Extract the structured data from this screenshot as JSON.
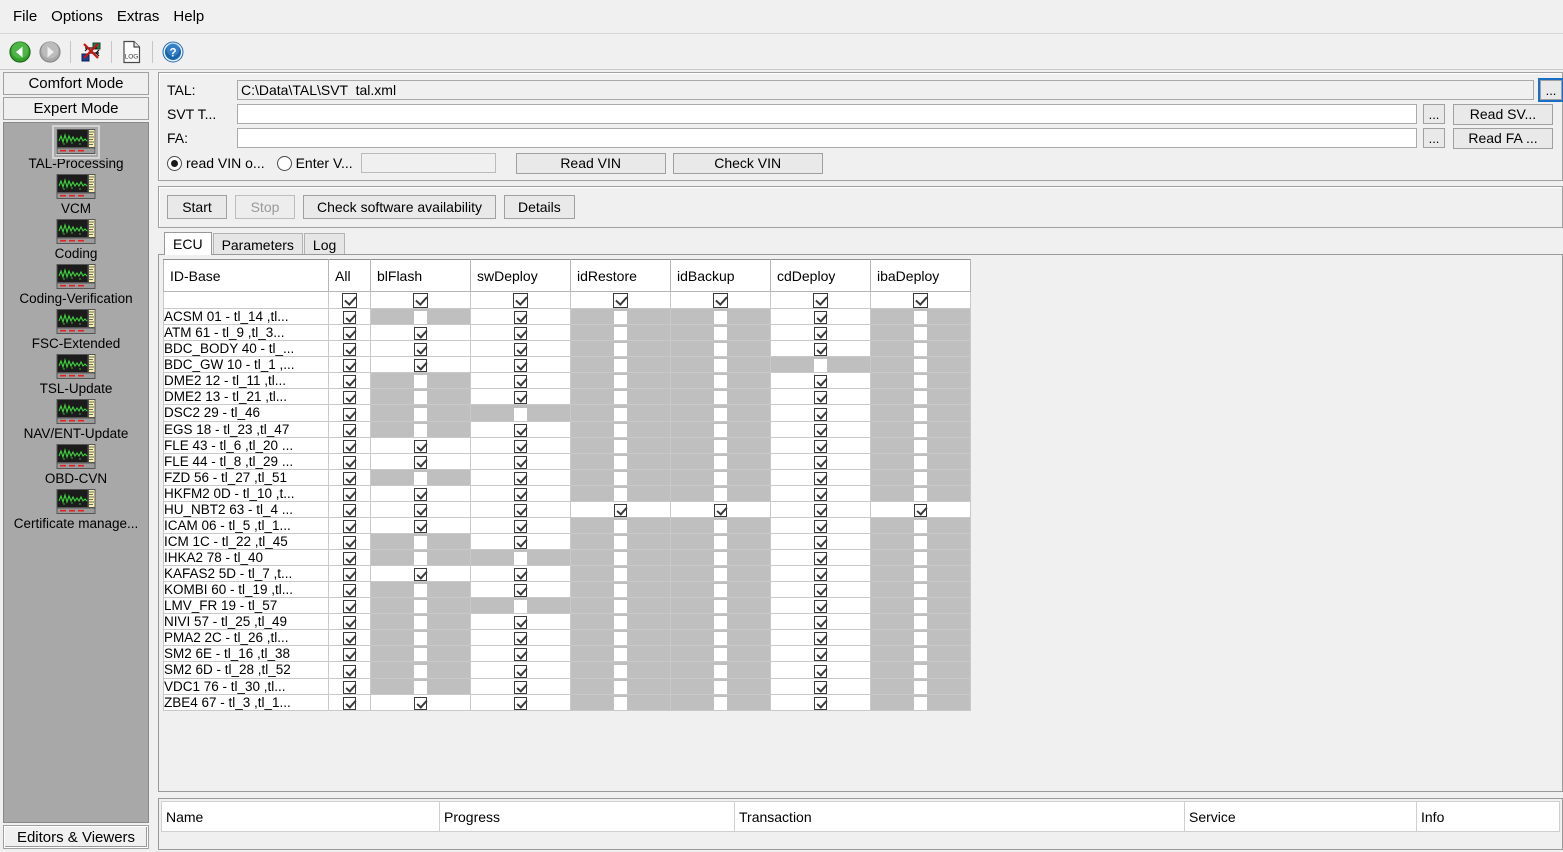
{
  "menubar": [
    "File",
    "Options",
    "Extras",
    "Help"
  ],
  "toolbar": {
    "buttons": [
      {
        "name": "back-icon",
        "title": "Back"
      },
      {
        "name": "forward-icon",
        "title": "Forward"
      },
      {
        "name": "network-icon",
        "title": "Connections"
      },
      {
        "name": "log-document-icon",
        "title": "Log"
      },
      {
        "name": "help-icon",
        "title": "Help"
      }
    ]
  },
  "sidebar": {
    "comfort_mode": "Comfort Mode",
    "expert_mode": "Expert Mode",
    "editors_viewers": "Editors & Viewers",
    "items": [
      {
        "label": "TAL-Processing",
        "selected": true
      },
      {
        "label": "VCM",
        "selected": false
      },
      {
        "label": "Coding",
        "selected": false
      },
      {
        "label": "Coding-Verification",
        "selected": false
      },
      {
        "label": "FSC-Extended",
        "selected": false
      },
      {
        "label": "TSL-Update",
        "selected": false
      },
      {
        "label": "NAV/ENT-Update",
        "selected": false
      },
      {
        "label": "OBD-CVN",
        "selected": false
      },
      {
        "label": "Certificate manage...",
        "selected": false
      }
    ]
  },
  "form": {
    "tal_label": "TAL:",
    "tal_value": "C:\\Data\\TAL\\SVT  tal.xml",
    "svt_label": "SVT T...",
    "svt_value": "",
    "fa_label": "FA:",
    "fa_value": "",
    "browse_label": "...",
    "read_svt_label": "Read SV...",
    "read_fa_label": "Read FA ...",
    "radio_read_vin": "read VIN o...",
    "radio_enter_vin": "Enter V...",
    "vin_value": "",
    "read_vin_button": "Read VIN",
    "check_vin_button": "Check VIN"
  },
  "actions": {
    "start": "Start",
    "stop": "Stop",
    "check_availability": "Check software availability",
    "details": "Details"
  },
  "tabs": [
    {
      "label": "ECU",
      "active": true
    },
    {
      "label": "Parameters",
      "active": false
    },
    {
      "label": "Log",
      "active": false
    }
  ],
  "grid": {
    "columns": [
      "ID-Base",
      "All",
      "blFlash",
      "swDeploy",
      "idRestore",
      "idBackup",
      "cdDeploy",
      "ibaDeploy"
    ],
    "filter_row": [
      null,
      "checked",
      "checked",
      "checked",
      "checked",
      "checked",
      "checked",
      "checked"
    ],
    "rows": [
      {
        "name": "ACSM 01 - tl_14 ,tl...",
        "cells": [
          "checked",
          "disabled",
          "checked",
          "disabled",
          "disabled",
          "checked",
          "disabled"
        ]
      },
      {
        "name": "ATM 61 - tl_9 ,tl_3...",
        "cells": [
          "checked",
          "checked",
          "checked",
          "disabled",
          "disabled",
          "checked",
          "disabled"
        ]
      },
      {
        "name": "BDC_BODY 40 - tl_...",
        "cells": [
          "checked",
          "checked",
          "checked",
          "disabled",
          "disabled",
          "checked",
          "disabled"
        ]
      },
      {
        "name": "BDC_GW 10 - tl_1 ,...",
        "cells": [
          "checked",
          "checked",
          "checked",
          "disabled",
          "disabled",
          "disabled",
          "disabled"
        ]
      },
      {
        "name": "DME2 12 - tl_11 ,tl...",
        "cells": [
          "checked",
          "disabled",
          "checked",
          "disabled",
          "disabled",
          "checked",
          "disabled"
        ]
      },
      {
        "name": "DME2 13 - tl_21 ,tl...",
        "cells": [
          "checked",
          "disabled",
          "checked",
          "disabled",
          "disabled",
          "checked",
          "disabled"
        ]
      },
      {
        "name": "DSC2 29 - tl_46",
        "cells": [
          "checked",
          "disabled",
          "disabled",
          "disabled",
          "disabled",
          "checked",
          "disabled"
        ]
      },
      {
        "name": "EGS 18 - tl_23 ,tl_47",
        "cells": [
          "checked",
          "disabled",
          "checked",
          "disabled",
          "disabled",
          "checked",
          "disabled"
        ]
      },
      {
        "name": "FLE 43 - tl_6 ,tl_20 ...",
        "cells": [
          "checked",
          "checked",
          "checked",
          "disabled",
          "disabled",
          "checked",
          "disabled"
        ]
      },
      {
        "name": "FLE 44 - tl_8 ,tl_29 ...",
        "cells": [
          "checked",
          "checked",
          "checked",
          "disabled",
          "disabled",
          "checked",
          "disabled"
        ]
      },
      {
        "name": "FZD 56 - tl_27 ,tl_51",
        "cells": [
          "checked",
          "disabled",
          "checked",
          "disabled",
          "disabled",
          "checked",
          "disabled"
        ]
      },
      {
        "name": "HKFM2 0D - tl_10 ,t...",
        "cells": [
          "checked",
          "checked",
          "checked",
          "disabled",
          "disabled",
          "checked",
          "disabled"
        ]
      },
      {
        "name": "HU_NBT2 63 - tl_4 ...",
        "cells": [
          "checked",
          "checked",
          "checked",
          "checked",
          "checked",
          "checked",
          "checked"
        ]
      },
      {
        "name": "ICAM 06 - tl_5 ,tl_1...",
        "cells": [
          "checked",
          "checked",
          "checked",
          "disabled",
          "disabled",
          "checked",
          "disabled"
        ]
      },
      {
        "name": "ICM 1C - tl_22 ,tl_45",
        "cells": [
          "checked",
          "disabled",
          "checked",
          "disabled",
          "disabled",
          "checked",
          "disabled"
        ]
      },
      {
        "name": "IHKA2 78 - tl_40",
        "cells": [
          "checked",
          "disabled",
          "disabled",
          "disabled",
          "disabled",
          "checked",
          "disabled"
        ]
      },
      {
        "name": "KAFAS2 5D - tl_7 ,t...",
        "cells": [
          "checked",
          "checked",
          "checked",
          "disabled",
          "disabled",
          "checked",
          "disabled"
        ]
      },
      {
        "name": "KOMBI 60 - tl_19 ,tl...",
        "cells": [
          "checked",
          "disabled",
          "checked",
          "disabled",
          "disabled",
          "checked",
          "disabled"
        ]
      },
      {
        "name": "LMV_FR 19 - tl_57",
        "cells": [
          "checked",
          "disabled",
          "disabled",
          "disabled",
          "disabled",
          "checked",
          "disabled"
        ]
      },
      {
        "name": "NIVI 57 - tl_25 ,tl_49",
        "cells": [
          "checked",
          "disabled",
          "checked",
          "disabled",
          "disabled",
          "checked",
          "disabled"
        ]
      },
      {
        "name": "PMA2 2C - tl_26 ,tl...",
        "cells": [
          "checked",
          "disabled",
          "checked",
          "disabled",
          "disabled",
          "checked",
          "disabled"
        ]
      },
      {
        "name": "SM2 6E - tl_16 ,tl_38",
        "cells": [
          "checked",
          "disabled",
          "checked",
          "disabled",
          "disabled",
          "checked",
          "disabled"
        ]
      },
      {
        "name": "SM2 6D - tl_28 ,tl_52",
        "cells": [
          "checked",
          "disabled",
          "checked",
          "disabled",
          "disabled",
          "checked",
          "disabled"
        ]
      },
      {
        "name": "VDC1 76 - tl_30 ,tl...",
        "cells": [
          "checked",
          "disabled",
          "checked",
          "disabled",
          "disabled",
          "checked",
          "disabled"
        ]
      },
      {
        "name": "ZBE4 67 - tl_3 ,tl_1...",
        "cells": [
          "checked",
          "checked",
          "checked",
          "disabled",
          "disabled",
          "checked",
          "disabled"
        ]
      }
    ]
  },
  "status_table": {
    "columns": [
      "Name",
      "Progress",
      "Transaction",
      "Service",
      "Info"
    ],
    "rows": []
  },
  "colors": {
    "disabled_cell": "#bfbfbf",
    "panel_bg": "#f0f0f0",
    "nav_bg": "#a8a8a8"
  }
}
